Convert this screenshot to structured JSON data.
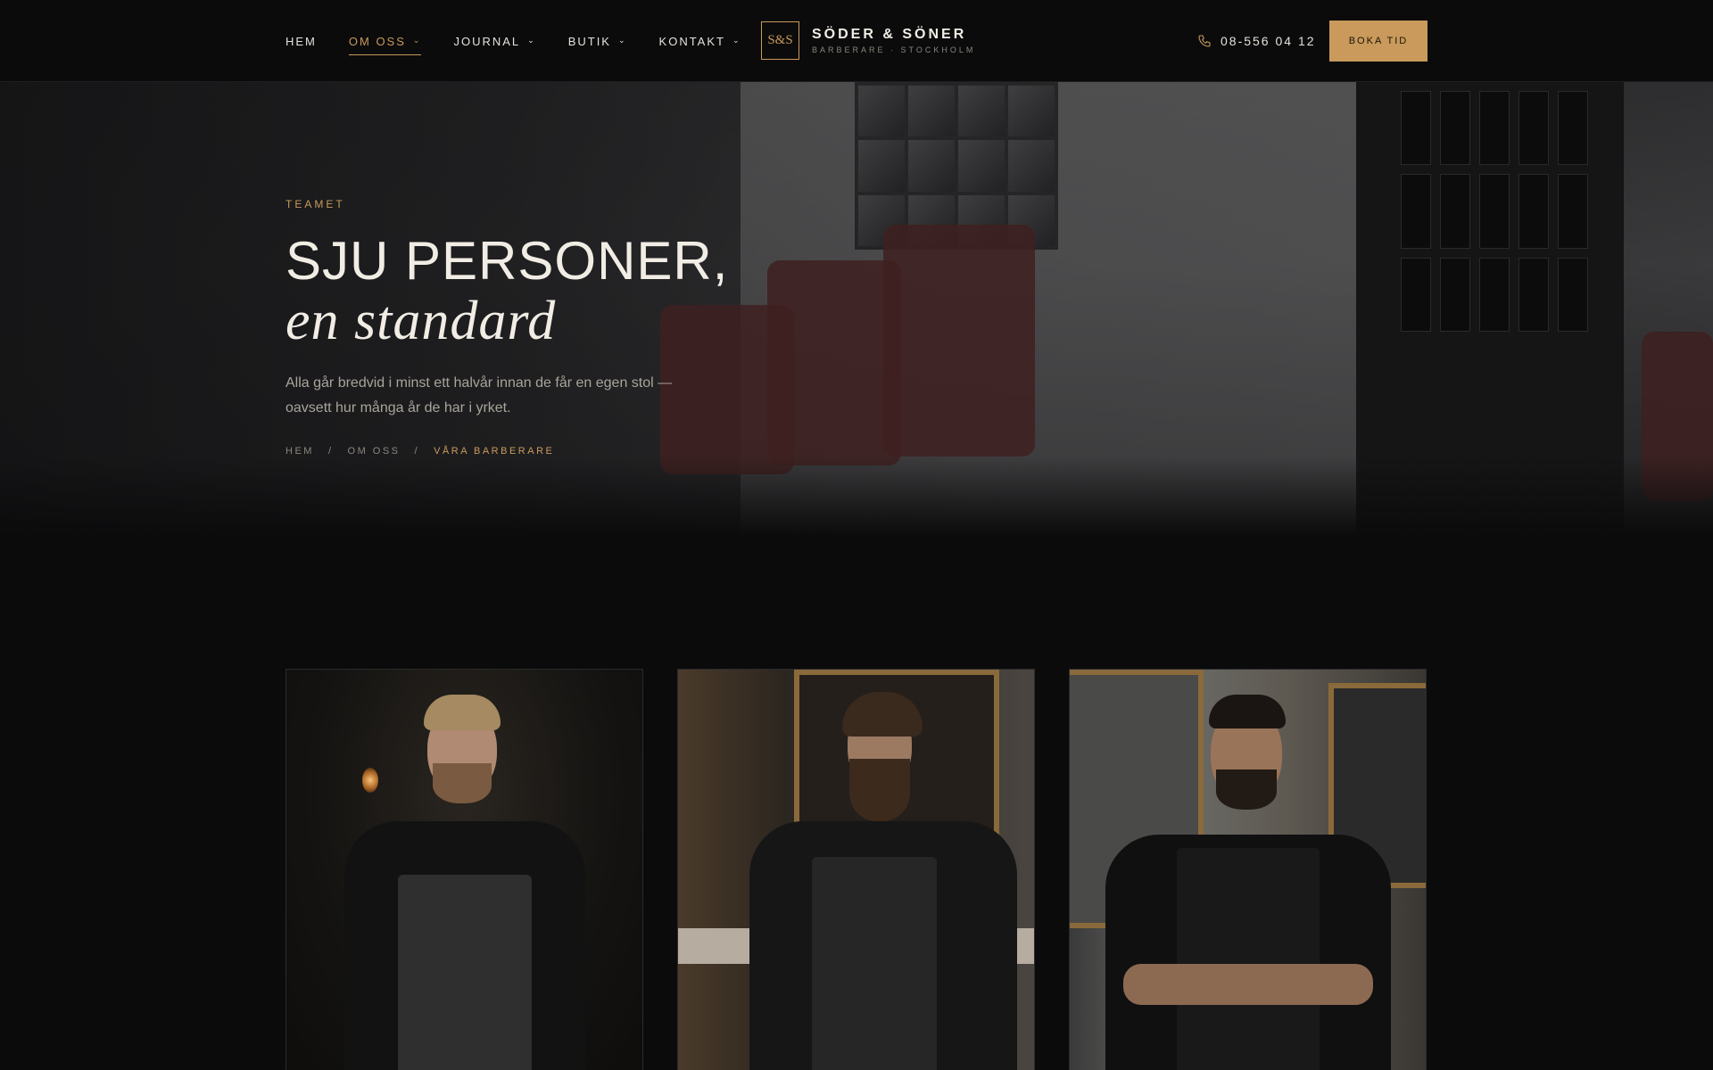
{
  "nav": {
    "items": [
      {
        "label": "HEM",
        "has_dropdown": false,
        "active": false
      },
      {
        "label": "OM OSS",
        "has_dropdown": true,
        "active": true
      },
      {
        "label": "JOURNAL",
        "has_dropdown": true,
        "active": false
      },
      {
        "label": "BUTIK",
        "has_dropdown": true,
        "active": false
      },
      {
        "label": "KONTAKT",
        "has_dropdown": true,
        "active": false
      }
    ]
  },
  "brand": {
    "mark": "S&S",
    "name": "SÖDER & SÖNER",
    "tagline": "BARBERARE · STOCKHOLM"
  },
  "header": {
    "phone": "08-556 04 12",
    "phone_icon": "phone-icon",
    "cta_label": "BOKA TID"
  },
  "hero": {
    "eyebrow": "TEAMET",
    "title_line1": "SJU PERSONER,",
    "title_line2": "en standard",
    "text": "Alla går bredvid i minst ett halvår innan de får en egen stol — oavsett hur många år de har i yrket.",
    "breadcrumb": [
      "HEM",
      "OM OSS",
      "VÅRA BARBERARE"
    ],
    "breadcrumb_separator": "/"
  },
  "team": {
    "cards": [
      {
        "image": "barber-portrait-1"
      },
      {
        "image": "barber-portrait-2"
      },
      {
        "image": "barber-portrait-3"
      }
    ]
  },
  "colors": {
    "accent": "#c99a5b",
    "background": "#0b0b0c",
    "text": "#e6e2da"
  }
}
